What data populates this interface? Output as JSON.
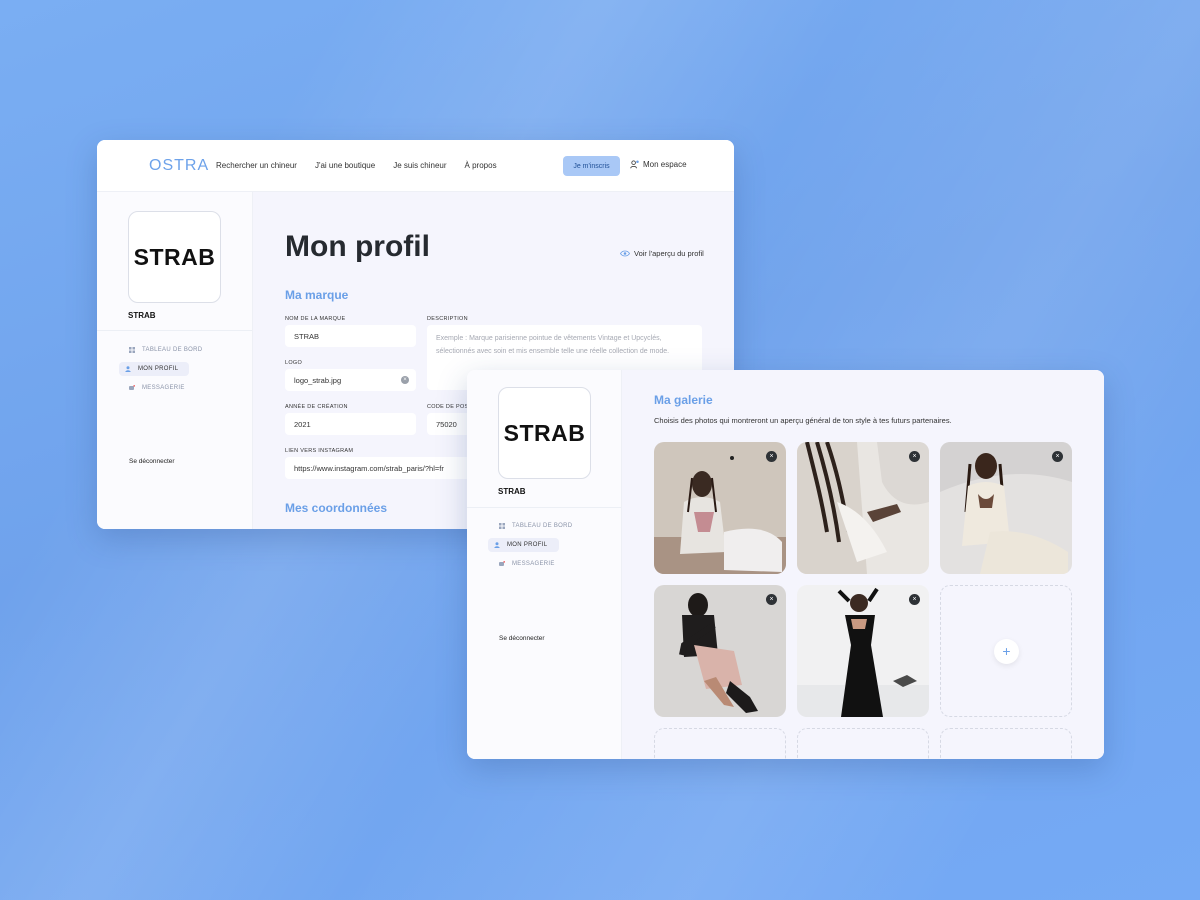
{
  "nav": {
    "logo": "OSTRA",
    "links": [
      "Rechercher un chineur",
      "J'ai une boutique",
      "Je suis chineur",
      "À propos"
    ],
    "register": "Je m'inscris",
    "account": "Mon espace"
  },
  "brand": {
    "logo_text": "STRAB",
    "name": "STRAB"
  },
  "sidebar": {
    "items": [
      {
        "label": "TABLEAU DE BORD",
        "icon": "dashboard-icon"
      },
      {
        "label": "MON PROFIL",
        "icon": "user-icon"
      },
      {
        "label": "MESSAGERIE",
        "icon": "chat-icon"
      }
    ],
    "logout": "Se déconnecter"
  },
  "profile": {
    "title": "Mon profil",
    "preview_link": "Voir l'aperçu du profil",
    "section_brand": "Ma marque",
    "section_contact": "Mes coordonnées",
    "fields": {
      "brand_name": {
        "label": "NOM DE LA MARQUE",
        "value": "STRAB"
      },
      "logo": {
        "label": "LOGO",
        "value": "logo_strab.jpg"
      },
      "year": {
        "label": "ANNÉE DE CRÉATION",
        "value": "2021"
      },
      "postal": {
        "label": "CODE DE POSTAL",
        "value": "75020"
      },
      "instagram": {
        "label": "LIEN VERS INSTAGRAM",
        "value": "https://www.instagram.com/strab_paris/?hl=fr"
      },
      "description": {
        "label": "DESCRIPTION",
        "placeholder": "Exemple : Marque parisienne pointue de vêtements Vintage et Upcyclés, sélectionnés avec soin et mis ensemble telle une réelle collection de mode."
      }
    }
  },
  "gallery": {
    "title": "Ma galerie",
    "subtitle": "Choisis des photos qui montreront un aperçu général de ton style à tes futurs partenaires.",
    "remove_glyph": "×",
    "add_glyph": "+"
  },
  "colors": {
    "accent": "#6a9fe7",
    "button": "#a9c8f6",
    "background": "#74a9f1"
  }
}
